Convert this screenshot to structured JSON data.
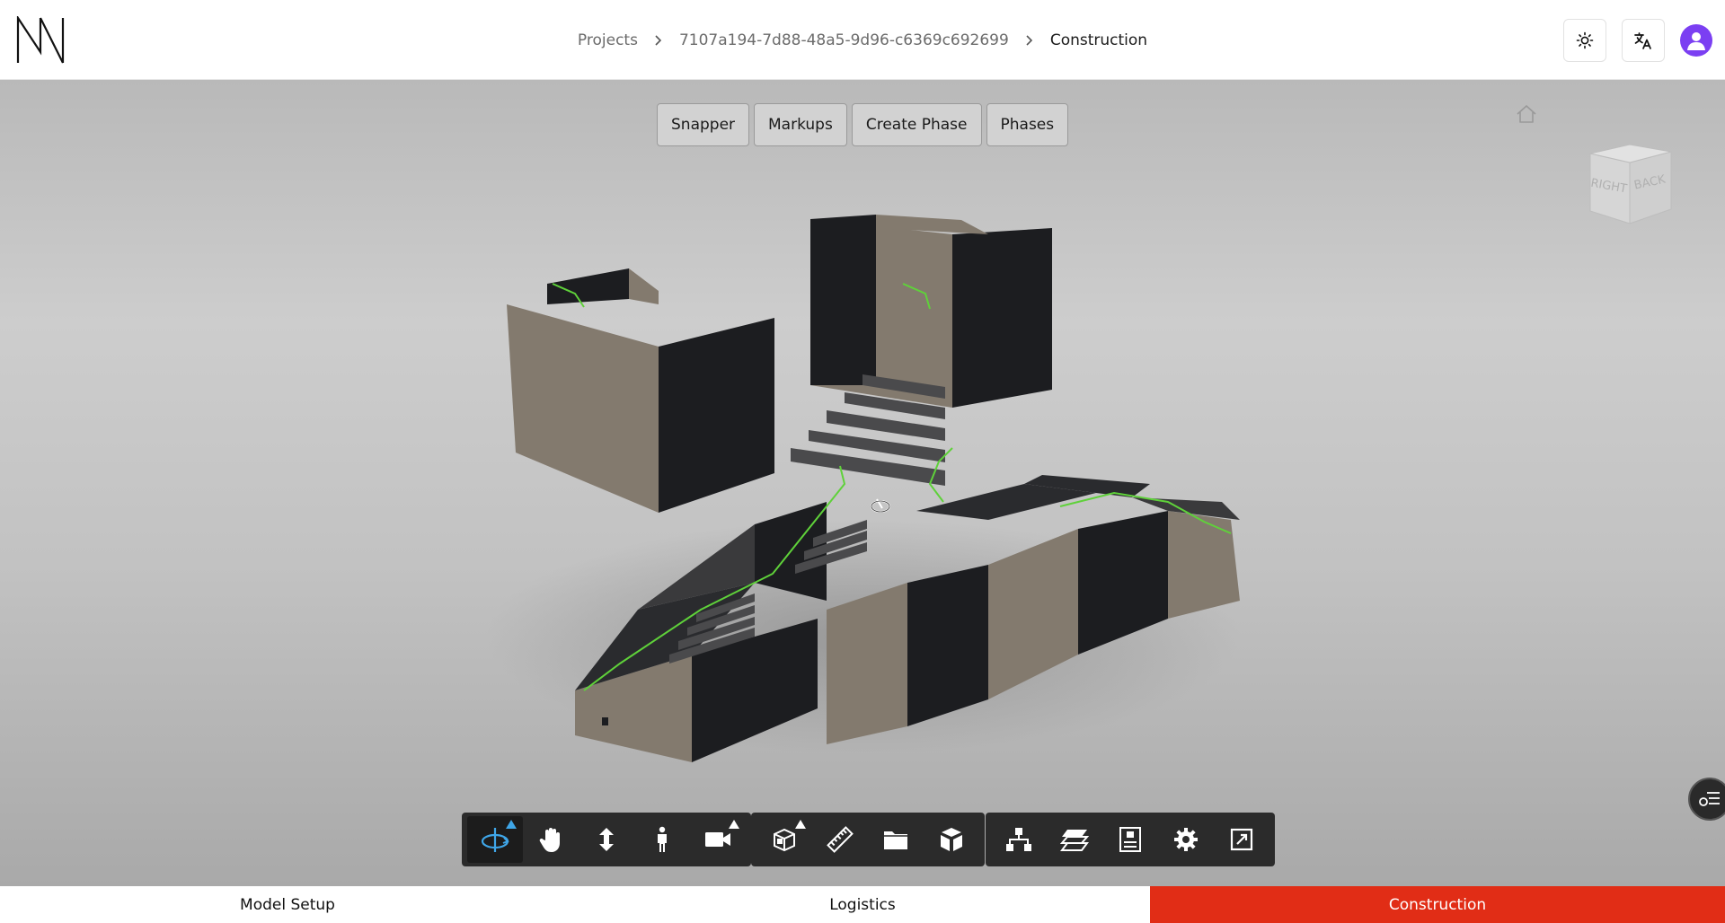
{
  "header": {
    "breadcrumb": [
      "Projects",
      "7107a194-7d88-48a5-9d96-c6369c692699",
      "Construction"
    ]
  },
  "viewer": {
    "top_tools": [
      "Snapper",
      "Markups",
      "Create Phase",
      "Phases"
    ],
    "view_cube": {
      "faces": [
        "RIGHT",
        "BACK"
      ]
    }
  },
  "toolbar": {
    "groups": [
      [
        "orbit-icon",
        "pan-hand-icon",
        "zoom-vertical-icon",
        "first-person-icon",
        "camera-icon"
      ],
      [
        "section-box-icon",
        "measure-ruler-icon",
        "folder-icon",
        "explode-model-icon"
      ],
      [
        "model-tree-icon",
        "layers-icon",
        "properties-icon",
        "settings-gear-icon",
        "fullscreen-icon"
      ]
    ],
    "active": "orbit-icon"
  },
  "tabs": [
    "Model Setup",
    "Logistics",
    "Construction"
  ],
  "active_tab": "Construction",
  "colors": {
    "accent": "#e12d16",
    "avatar": "#7b3ff2",
    "toolbar": "#2b2b2b",
    "active_tool": "#3fa6e8"
  }
}
